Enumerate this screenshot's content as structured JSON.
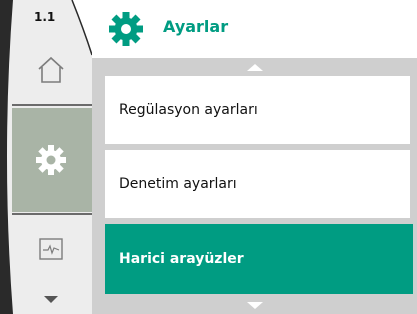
{
  "nav": {
    "page_number": "1.1",
    "items": [
      {
        "icon": "home-icon",
        "state": "inactive"
      },
      {
        "icon": "gear-icon",
        "state": "active"
      },
      {
        "icon": "diagnostics-icon",
        "state": "inactive"
      }
    ],
    "scroll_down_icon": "chevron-down-icon"
  },
  "header": {
    "icon": "gear-icon",
    "title": "Ayarlar"
  },
  "menu": {
    "items": [
      {
        "label": "Regülasyon ayarları",
        "selected": false
      },
      {
        "label": "Denetim ayarları",
        "selected": false
      },
      {
        "label": "Harici arayüzler",
        "selected": true
      }
    ]
  },
  "colors": {
    "accent": "#009c82",
    "panel": "#cfcfcf",
    "rail_active": "#a9b4a6",
    "rail": "#ededed"
  }
}
